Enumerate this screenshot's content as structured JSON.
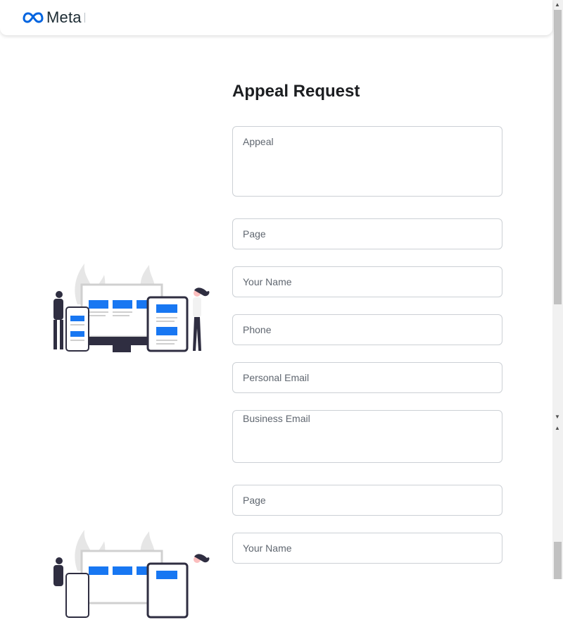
{
  "header": {
    "brand": "Meta"
  },
  "form": {
    "title": "Appeal Request",
    "appeal_placeholder": "Appeal",
    "page_placeholder": "Page",
    "name_placeholder": "Your Name",
    "phone_placeholder": "Phone",
    "personal_email_placeholder": "Personal Email",
    "business_email_placeholder": "Business Email"
  },
  "form_repeat": {
    "page_placeholder": "Page",
    "name_placeholder": "Your Name"
  },
  "colors": {
    "accent": "#1877f2",
    "dark": "#2f2e41",
    "ghost": "#e6e6e6"
  }
}
